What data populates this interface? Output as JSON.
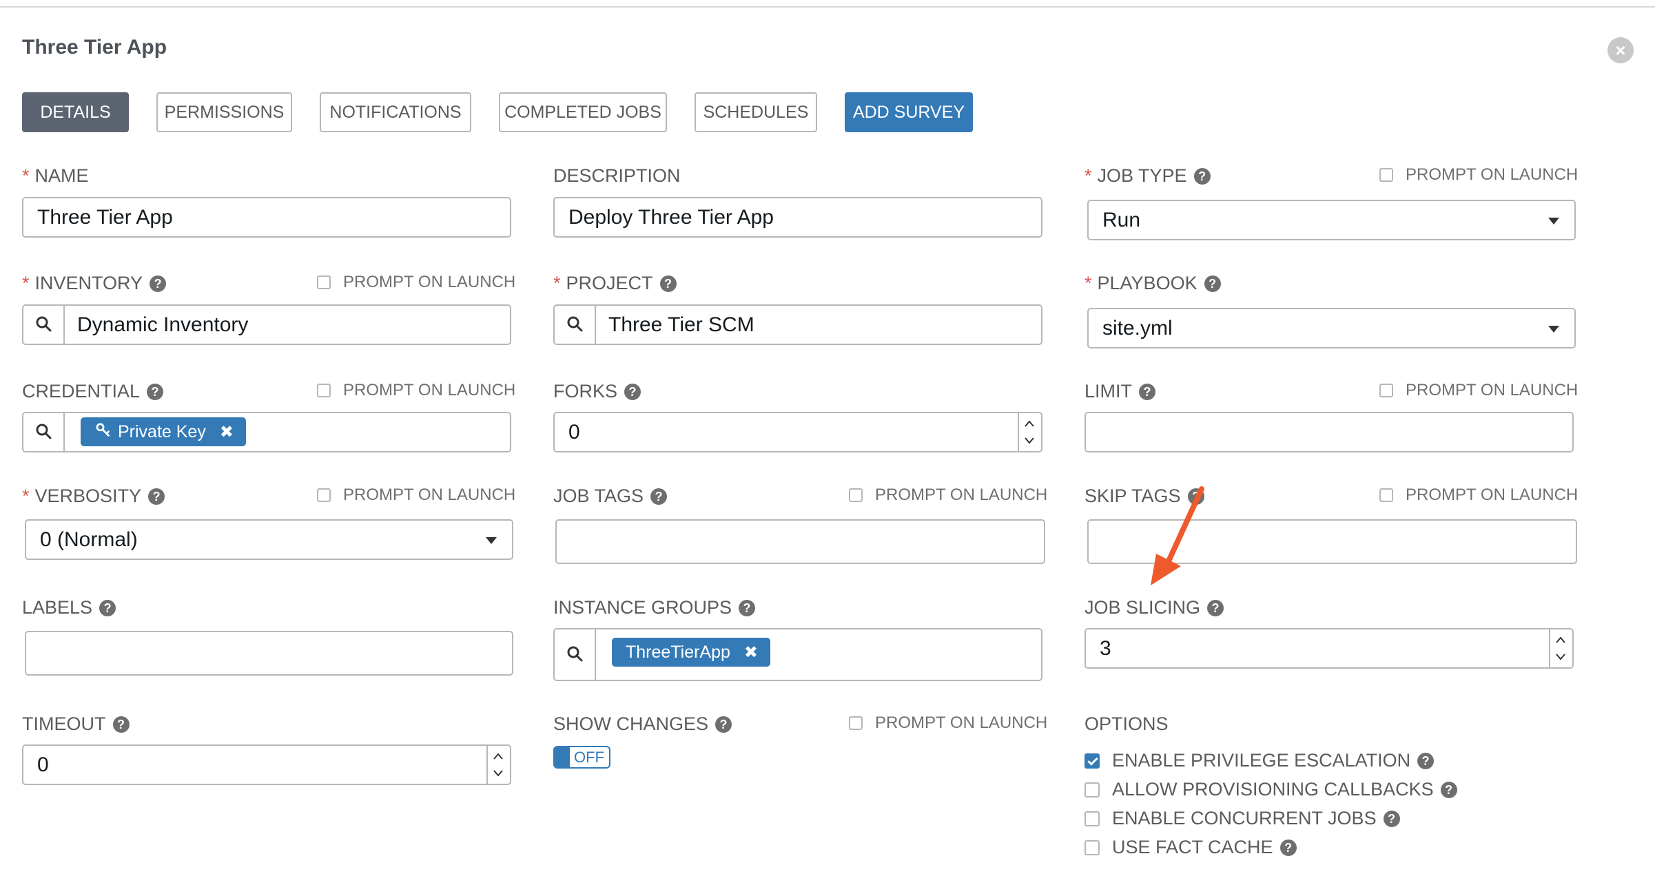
{
  "header": {
    "title": "Three Tier App"
  },
  "tabs": [
    {
      "label": "DETAILS",
      "active": true
    },
    {
      "label": "PERMISSIONS"
    },
    {
      "label": "NOTIFICATIONS"
    },
    {
      "label": "COMPLETED JOBS"
    },
    {
      "label": "SCHEDULES"
    },
    {
      "label": "ADD SURVEY"
    }
  ],
  "prompt_on_launch": "PROMPT ON LAUNCH",
  "fields": {
    "name": {
      "label": "NAME",
      "value": "Three Tier App"
    },
    "description": {
      "label": "DESCRIPTION",
      "value": "Deploy Three Tier App"
    },
    "job_type": {
      "label": "JOB TYPE",
      "value": "Run"
    },
    "inventory": {
      "label": "INVENTORY",
      "value": "Dynamic Inventory"
    },
    "project": {
      "label": "PROJECT",
      "value": "Three Tier SCM"
    },
    "playbook": {
      "label": "PLAYBOOK",
      "value": "site.yml"
    },
    "credential": {
      "label": "CREDENTIAL",
      "chip": "Private Key"
    },
    "forks": {
      "label": "FORKS",
      "value": "0"
    },
    "limit": {
      "label": "LIMIT",
      "value": ""
    },
    "verbosity": {
      "label": "VERBOSITY",
      "value": "0 (Normal)"
    },
    "job_tags": {
      "label": "JOB TAGS",
      "value": ""
    },
    "skip_tags": {
      "label": "SKIP TAGS",
      "value": ""
    },
    "labels": {
      "label": "LABELS",
      "value": ""
    },
    "instance_groups": {
      "label": "INSTANCE GROUPS",
      "chip": "ThreeTierApp"
    },
    "job_slicing": {
      "label": "JOB SLICING",
      "value": "3"
    },
    "timeout": {
      "label": "TIMEOUT",
      "value": "0"
    },
    "show_changes": {
      "label": "SHOW CHANGES",
      "toggle": "OFF"
    }
  },
  "options": {
    "label": "OPTIONS",
    "items": [
      {
        "label": "ENABLE PRIVILEGE ESCALATION",
        "checked": true
      },
      {
        "label": "ALLOW PROVISIONING CALLBACKS",
        "checked": false
      },
      {
        "label": "ENABLE CONCURRENT JOBS",
        "checked": false
      },
      {
        "label": "USE FACT CACHE",
        "checked": false
      }
    ]
  },
  "icons": {
    "help": "?",
    "close": "×",
    "chip_remove": "✖"
  },
  "colors": {
    "primary": "#337ab7",
    "active_tab": "#5b6470",
    "required": "#d9534f",
    "annotation_arrow": "#ee5a2c"
  }
}
